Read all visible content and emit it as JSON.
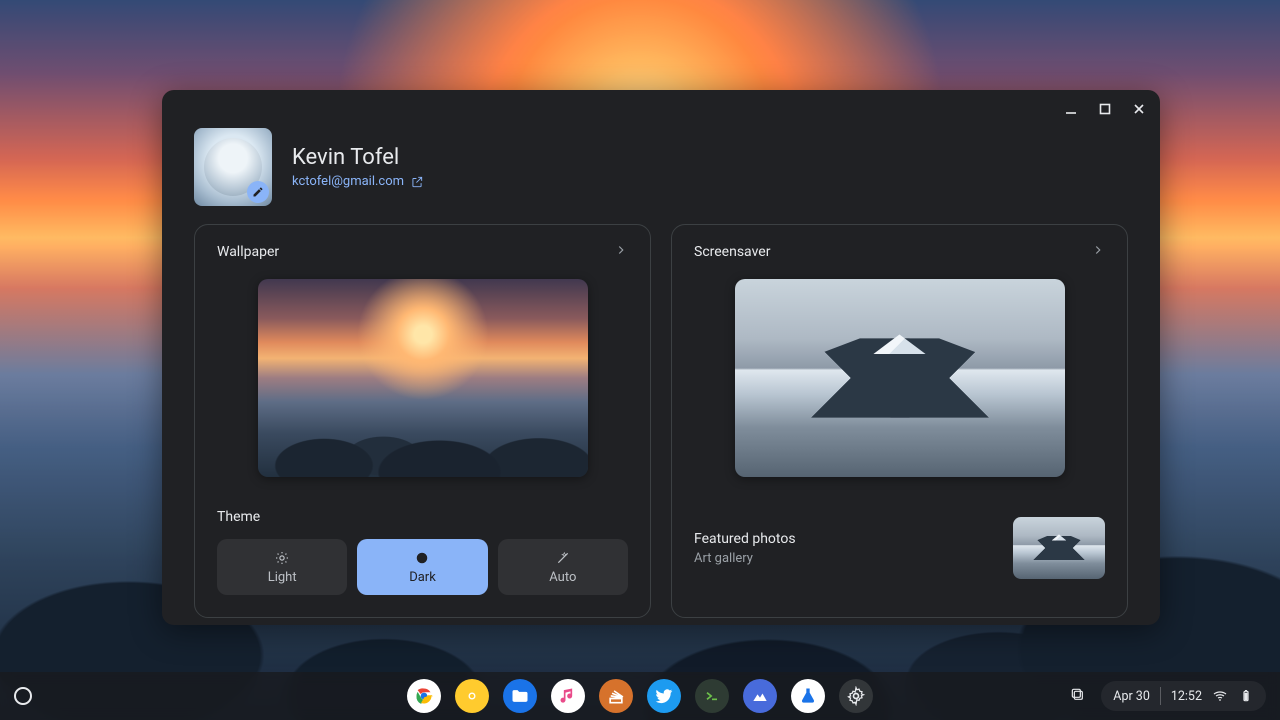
{
  "profile": {
    "name": "Kevin Tofel",
    "email": "kctofel@gmail.com"
  },
  "window_controls": {
    "minimize": "Minimize",
    "maximize": "Maximize",
    "close": "Close"
  },
  "wallpaper_card": {
    "title": "Wallpaper",
    "theme_label": "Theme",
    "theme_options": {
      "light": "Light",
      "dark": "Dark",
      "auto": "Auto"
    },
    "selected_theme": "dark"
  },
  "screensaver_card": {
    "title": "Screensaver",
    "info_title": "Featured photos",
    "info_subtitle": "Art gallery"
  },
  "shelf": {
    "date": "Apr 30",
    "time": "12:52"
  },
  "colors": {
    "accent": "#8ab4f8",
    "panel": "#202124",
    "card_border": "#3c4043"
  }
}
